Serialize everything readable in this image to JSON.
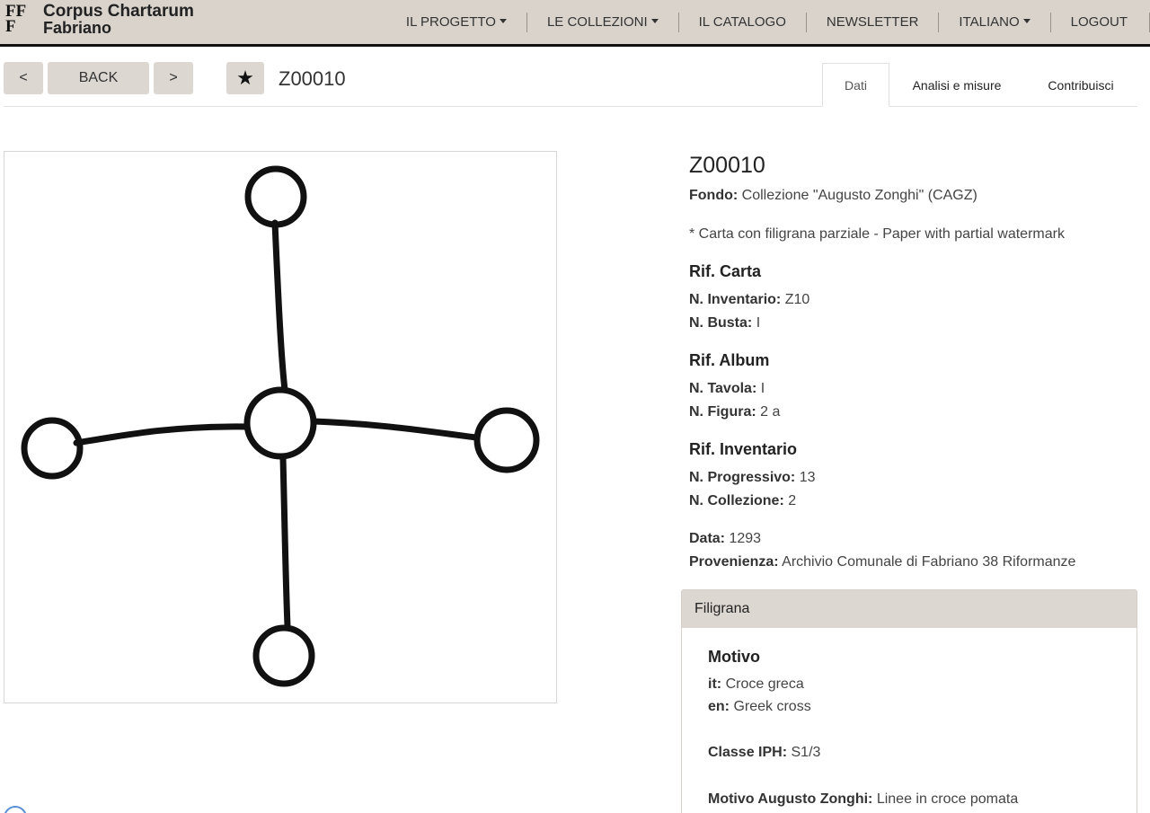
{
  "brand": {
    "mark_top": "FF",
    "mark_bottom": "F",
    "name_line1": "Corpus Chartarum",
    "name_line2": "Fabriano"
  },
  "nav": {
    "progetto": "IL PROGETTO",
    "collezioni": "LE COLLEZIONI",
    "catalogo": "IL CATALOGO",
    "newsletter": "NEWSLETTER",
    "language": "ITALIANO",
    "logout": "LOGOUT"
  },
  "toolbar": {
    "prev": "<",
    "back": "BACK",
    "next": ">",
    "star": "★",
    "record_id": "Z00010"
  },
  "tabs": {
    "dati": "Dati",
    "analisi": "Analisi e misure",
    "contribuisci": "Contribuisci"
  },
  "record": {
    "title": "Z00010",
    "fondo_label": "Fondo:",
    "fondo_value": "Collezione \"Augusto Zonghi\" (CAGZ)",
    "note": "* Carta con filigrana parziale - Paper with partial watermark",
    "rif_carta": "Rif. Carta",
    "inventario_label": "N. Inventario:",
    "inventario_value": "Z10",
    "busta_label": "N. Busta:",
    "busta_value": "I",
    "rif_album": "Rif. Album",
    "tavola_label": "N. Tavola:",
    "tavola_value": "I",
    "figura_label": "N. Figura:",
    "figura_value": "2 a",
    "rif_inventario": "Rif. Inventario",
    "progressivo_label": "N. Progressivo:",
    "progressivo_value": "13",
    "collezione_label": "N. Collezione:",
    "collezione_value": "2",
    "data_label": "Data:",
    "data_value": "1293",
    "provenienza_label": "Provenienza:",
    "provenienza_value": "Archivio Comunale di Fabriano 38 Riformanze"
  },
  "filigrana": {
    "header": "Filigrana",
    "motivo": "Motivo",
    "it_label": "it:",
    "it_value": "Croce greca",
    "en_label": "en:",
    "en_value": "Greek cross",
    "classe_label": "Classe IPH:",
    "classe_value": "S1/3",
    "zonghi_label": "Motivo Augusto Zonghi:",
    "zonghi_value": "Linee in croce pomata"
  }
}
